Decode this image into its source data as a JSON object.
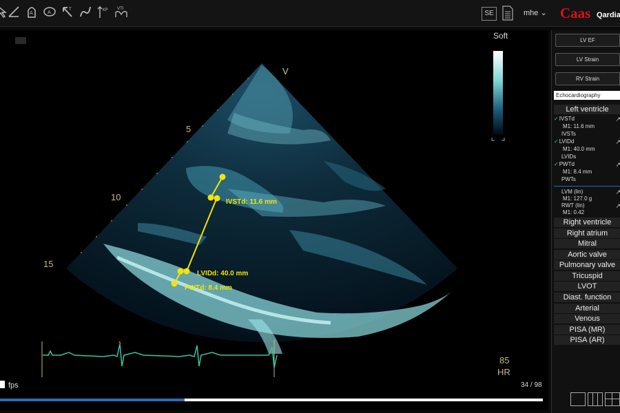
{
  "toolbar": {
    "tools": [
      "select-icon",
      "angle-icon",
      "area-icon",
      "ellipse-icon",
      "arrow-icon",
      "curve-icon",
      "velocity-icon",
      "vti-icon"
    ],
    "se_label": "SE",
    "user": "mhe ⌄",
    "logo": "Caas",
    "logo_sub": "Qardia"
  },
  "viewer": {
    "gain_label": "Soft",
    "scale_marker": "V",
    "depth_ticks": [
      "5",
      "10",
      "15"
    ],
    "heart_rate_value": "85",
    "heart_rate_unit": "HR",
    "fps_label": "fps",
    "frame_counter": "34 / 98",
    "playback_progress": 0.34,
    "measurements": [
      {
        "label": "IVSTd: 11.6 mm"
      },
      {
        "label": "LVIDd: 40.0 mm"
      },
      {
        "label": "PWTd: 8.4 mm"
      }
    ]
  },
  "sidebar": {
    "buttons": [
      "LV EF",
      "LV Strain",
      "RV Strain"
    ],
    "modality_select": "Echocardiography",
    "section_open": "Left ventricle",
    "lv_items": [
      {
        "name": "IVSTd",
        "checked": true,
        "value": "M1: 11.6 mm"
      },
      {
        "name": "IVSTs",
        "checked": false,
        "value": ""
      },
      {
        "name": "LVIDd",
        "checked": true,
        "value": "M1: 40.0 mm"
      },
      {
        "name": "LVIDs",
        "checked": false,
        "value": ""
      },
      {
        "name": "PWTd",
        "checked": true,
        "value": "M1: 8.4 mm"
      },
      {
        "name": "PWTs",
        "checked": false,
        "value": ""
      }
    ],
    "derived": [
      {
        "name": "LVM (lin)",
        "value": "M1: 127.0 g"
      },
      {
        "name": "RWT (lin)",
        "value": "M1: 0.42"
      }
    ],
    "sections": [
      "Right ventricle",
      "Right atrium",
      "Mitral",
      "Aortic valve",
      "Pulmonary valve",
      "Tricuspid",
      "LVOT",
      "Diast. function",
      "Arterial",
      "Venous",
      "PISA (MR)",
      "PISA (AR)"
    ]
  },
  "colors": {
    "measurement": "#f5e400",
    "ecg": "#39c6a0",
    "logo": "#d4141c",
    "accent_blue": "#2c6bb4"
  }
}
